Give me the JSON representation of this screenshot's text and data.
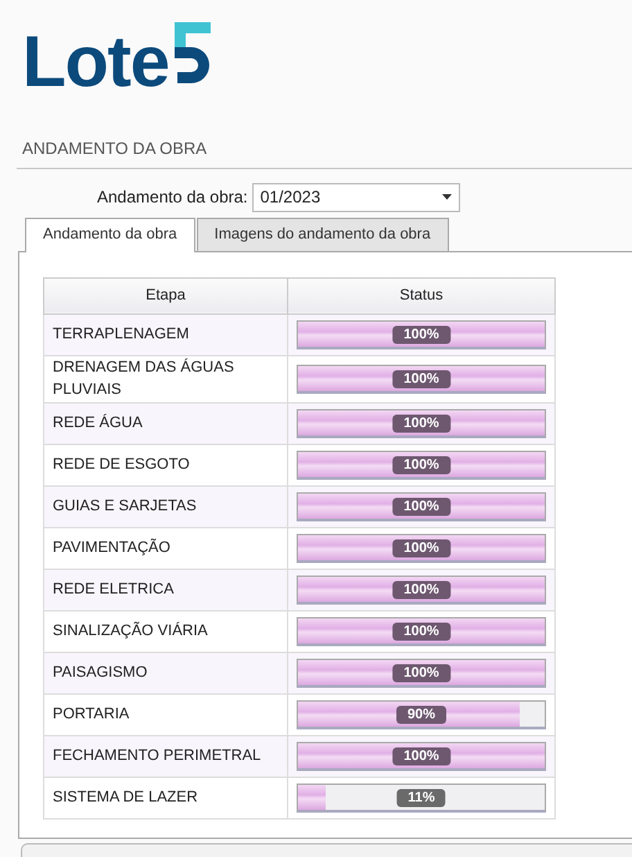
{
  "logo": {
    "text": "Lote"
  },
  "section": {
    "title": "ANDAMENTO DA OBRA"
  },
  "filter": {
    "label": "Andamento da obra:",
    "value": "01/2023"
  },
  "tabs": [
    {
      "label": "Andamento da obra",
      "selected": true
    },
    {
      "label": "Imagens do andamento da obra",
      "selected": false
    }
  ],
  "table": {
    "columns": [
      "Etapa",
      "Status"
    ],
    "rows": [
      {
        "etapa": "TERRAPLENAGEM",
        "level": 1,
        "reading": "100%"
      },
      {
        "etapa": "DRENAGEM DAS ÁGUAS PLUVIAIS",
        "level": 1,
        "reading": "100%"
      },
      {
        "etapa": "REDE ÁGUA",
        "level": 1,
        "reading": "100%"
      },
      {
        "etapa": "REDE DE ESGOTO",
        "level": 1,
        "reading": "100%"
      },
      {
        "etapa": "GUIAS E SARJETAS",
        "level": 1,
        "reading": "100%"
      },
      {
        "etapa": "PAVIMENTAÇÃO",
        "level": 1,
        "reading": "100%"
      },
      {
        "etapa": "REDE ELETRICA",
        "level": 1,
        "reading": "100%"
      },
      {
        "etapa": "SINALIZAÇÃO VIÁRIA",
        "level": 1,
        "reading": "100%"
      },
      {
        "etapa": "PAISAGISMO",
        "level": 1,
        "reading": "100%"
      },
      {
        "etapa": "PORTARIA",
        "level": 0.9,
        "reading": "90%"
      },
      {
        "etapa": "FECHAMENTO PERIMETRAL",
        "level": 1,
        "reading": "100%"
      },
      {
        "etapa": "SISTEMA DE LAZER",
        "level": 0.11,
        "reading": "11%"
      }
    ]
  }
}
